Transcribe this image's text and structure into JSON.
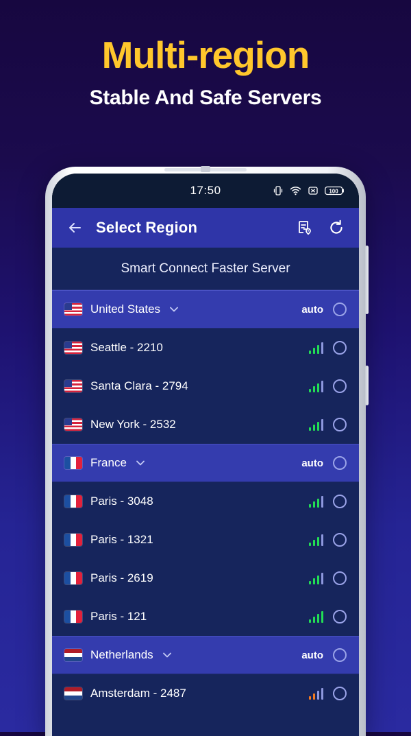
{
  "promo": {
    "title": "Multi-region",
    "subtitle": "Stable And Safe Servers",
    "title_color": "#FFC72C"
  },
  "status_bar": {
    "time": "17:50",
    "battery_level": "100",
    "icons": [
      "vibrate-icon",
      "wifi-icon",
      "no-sim-icon",
      "battery-icon"
    ]
  },
  "app_bar": {
    "back_label": "←",
    "title": "Select Region",
    "actions": [
      {
        "name": "server-list-location-icon"
      },
      {
        "name": "refresh-icon"
      }
    ]
  },
  "banner": {
    "text": "Smart Connect Faster Server"
  },
  "list": {
    "auto_label": "auto",
    "rows": [
      {
        "type": "group",
        "flag": "us",
        "label": "United States",
        "trailing": "auto",
        "signal": null
      },
      {
        "type": "server",
        "flag": "us",
        "label": "Seattle - 2210",
        "signal": {
          "level": 3,
          "color": "green"
        }
      },
      {
        "type": "server",
        "flag": "us",
        "label": "Santa Clara - 2794",
        "signal": {
          "level": 3,
          "color": "green"
        }
      },
      {
        "type": "server",
        "flag": "us",
        "label": "New York - 2532",
        "signal": {
          "level": 3,
          "color": "green"
        }
      },
      {
        "type": "group",
        "flag": "fr",
        "label": "France",
        "trailing": "auto",
        "signal": null
      },
      {
        "type": "server",
        "flag": "fr",
        "label": "Paris - 3048",
        "signal": {
          "level": 3,
          "color": "green"
        }
      },
      {
        "type": "server",
        "flag": "fr",
        "label": "Paris - 1321",
        "signal": {
          "level": 3,
          "color": "green"
        }
      },
      {
        "type": "server",
        "flag": "fr",
        "label": "Paris - 2619",
        "signal": {
          "level": 3,
          "color": "green"
        }
      },
      {
        "type": "server",
        "flag": "fr",
        "label": "Paris - 121",
        "signal": {
          "level": 4,
          "color": "green"
        }
      },
      {
        "type": "group",
        "flag": "nl",
        "label": "Netherlands",
        "trailing": "auto",
        "signal": null
      },
      {
        "type": "server",
        "flag": "nl",
        "label": "Amsterdam - 2487",
        "signal": {
          "level": 2,
          "color": "orange"
        }
      }
    ]
  },
  "colors": {
    "accent_yellow": "#FFC72C",
    "appbar_blue": "#2F35A8",
    "group_row": "#343CAE",
    "server_row": "#16255C",
    "signal_green": "#22DD55",
    "signal_orange": "#F47A20",
    "signal_dim": "#8E98DE",
    "radio_ring": "#9AA3E8"
  }
}
